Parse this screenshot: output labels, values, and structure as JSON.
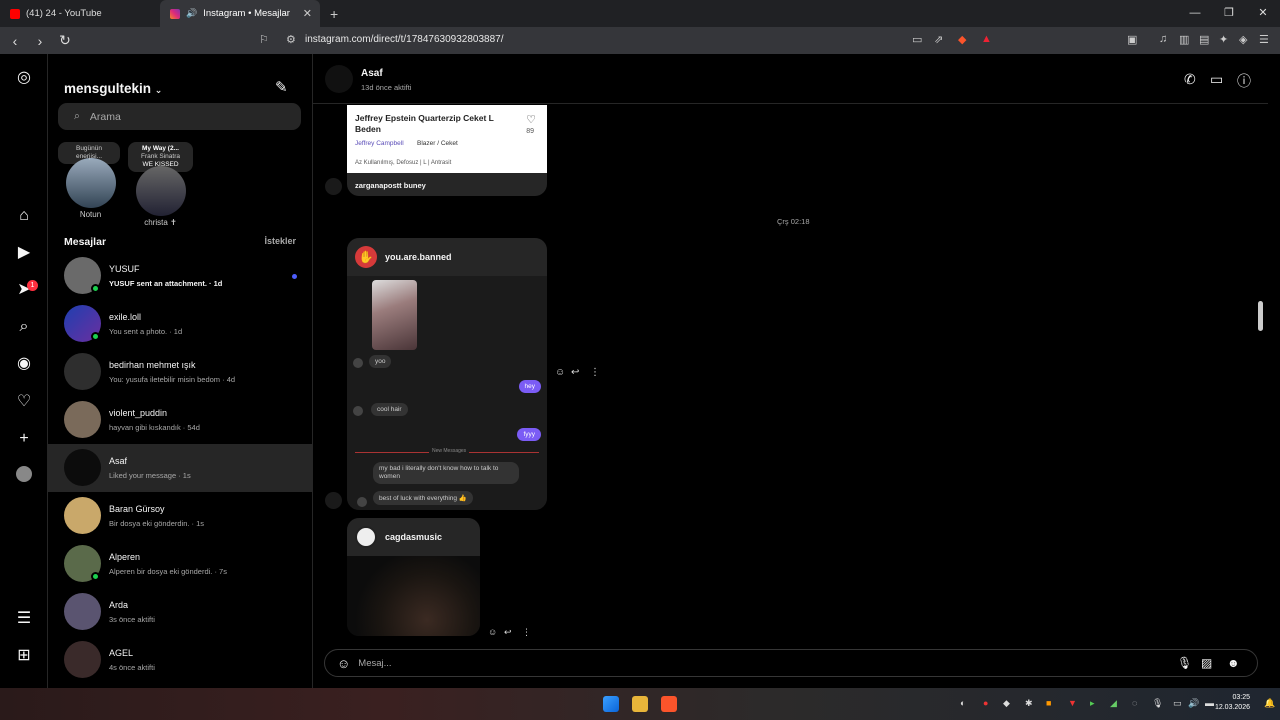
{
  "browser": {
    "tabs": [
      {
        "title": "(41) 24 - YouTube"
      },
      {
        "title": "Instagram • Mesajlar"
      }
    ],
    "url": "instagram.com/direct/t/17847630932803887/"
  },
  "colors": {
    "accent": "#4d5dfb",
    "online": "#1cd14f",
    "badge": "#ff3040",
    "my_bubble": "#7b5cf5"
  },
  "rail": {
    "notifications_badge": "1"
  },
  "inbox": {
    "username": "mensgultekin",
    "search_placeholder": "Arama",
    "notes": [
      {
        "bubble": "Bugünün enerjisi...",
        "label": "Notun"
      },
      {
        "bubble_title": "My Way (2...",
        "bubble_line2": "Frank Sinatra",
        "bubble_line3": "WE KISSED",
        "label": "christa ✝"
      }
    ],
    "messages_heading": "Mesajlar",
    "requests_label": "İstekler",
    "conversations": [
      {
        "name": "YUSUF",
        "preview": "YUSUF sent an attachment. · 1d",
        "online": true,
        "unread": true
      },
      {
        "name": "exile.loll",
        "preview": "You sent a photo. · 1d",
        "online": true
      },
      {
        "name": "bedirhan mehmet ışık",
        "preview": "You: yusufa iletebilir misin bedom · 4d"
      },
      {
        "name": "violent_puddin",
        "preview": "hayvan gibi kıskandık · 54d"
      },
      {
        "name": "Asaf",
        "preview": "Liked your message · 1s"
      },
      {
        "name": "Baran Gürsoy",
        "preview": "Bir dosya eki gönderdin. · 1s"
      },
      {
        "name": "Alperen",
        "preview": "Alperen bir dosya eki gönderdi. · 7s"
      },
      {
        "name": "Arda",
        "preview": "3s önce aktifti"
      },
      {
        "name": "AGEL",
        "preview": "4s önce aktifti"
      }
    ]
  },
  "chat": {
    "name": "Asaf",
    "status": "13d önce aktifti",
    "product": {
      "title": "Jeffrey Epstein Quarterzip Ceket L Beden",
      "likes": "89",
      "seller": "Jeffrey Campbell",
      "category": "Blazer / Ceket",
      "condition": "Az Kullanılmış, Defosuz   |   L   |   Antrasit"
    },
    "caption": "zarganapostt buney",
    "timestamp": "Çrş 02:18",
    "share_user": "you.are.banned",
    "screenshot_msgs": {
      "m1": "yoo",
      "m2": "hey",
      "m3": "cool hair",
      "m4": "fyyy",
      "new_messages": "New Messages",
      "m5": "my bad i literally don't know how to talk to women",
      "m6": "best of luck with everything 👍"
    },
    "share3_user": "cagdasmusic",
    "composer_placeholder": "Mesaj..."
  },
  "taskbar": {
    "time": "03:25",
    "date": "12.03.2026"
  }
}
